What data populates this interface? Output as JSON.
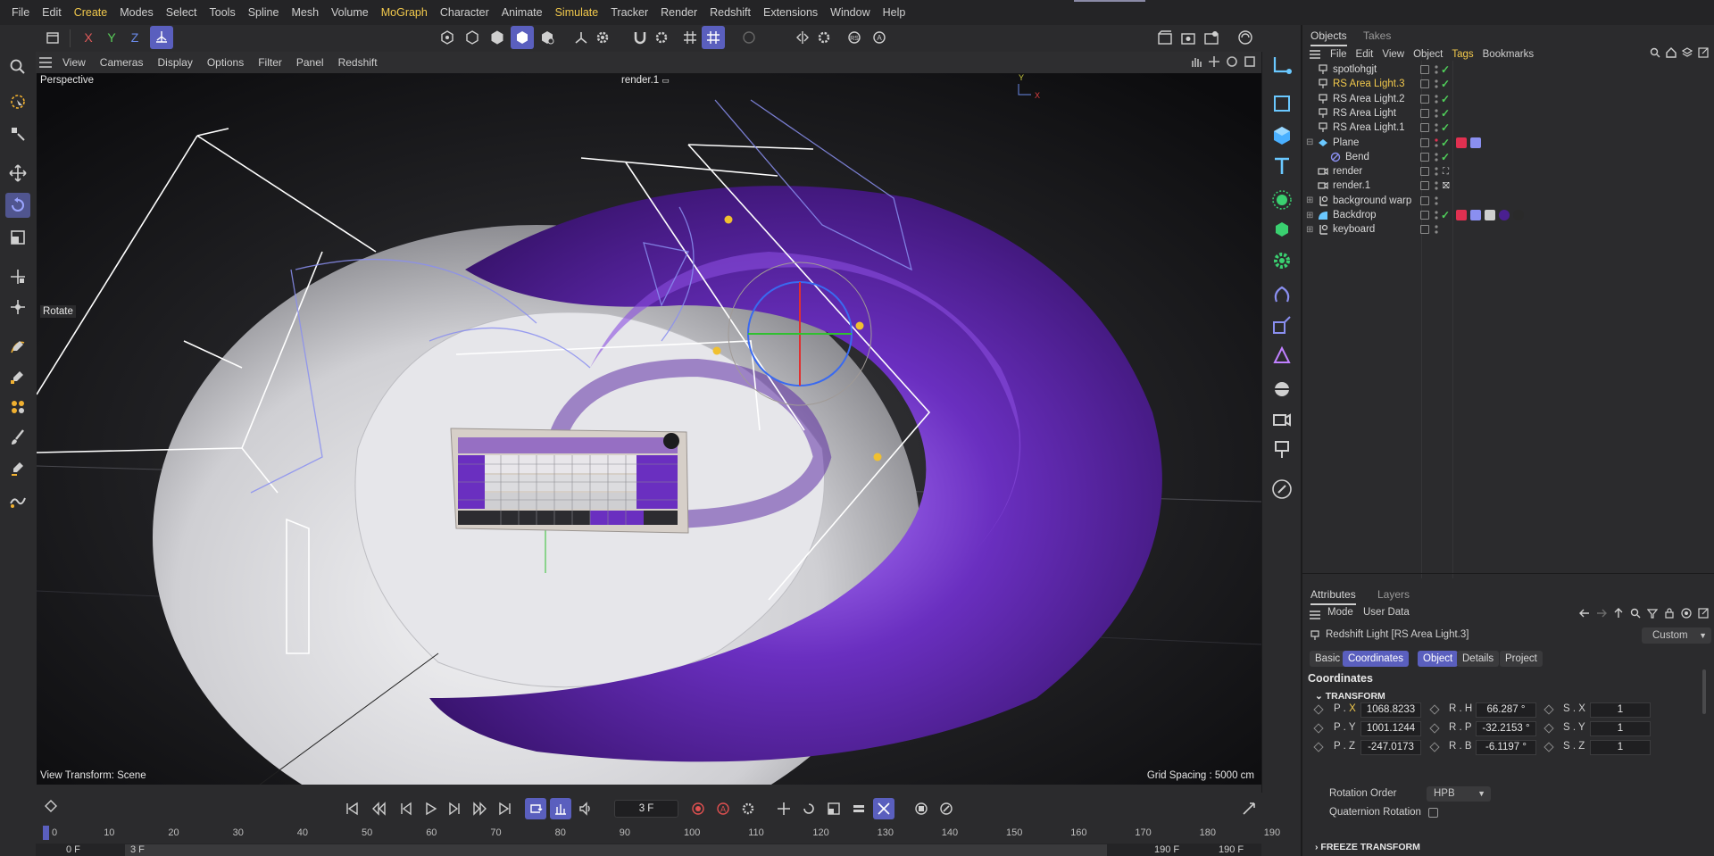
{
  "menu": [
    "File",
    "Edit",
    "Create",
    "Modes",
    "Select",
    "Tools",
    "Spline",
    "Mesh",
    "Volume",
    "MoGraph",
    "Character",
    "Animate",
    "Simulate",
    "Tracker",
    "Render",
    "Redshift",
    "Extensions",
    "Window",
    "Help"
  ],
  "menu_accent": [
    "Create",
    "MoGraph",
    "Simulate"
  ],
  "axis_buttons": [
    "X",
    "Y",
    "Z"
  ],
  "viewport_menu": [
    "View",
    "Cameras",
    "Display",
    "Options",
    "Filter",
    "Panel",
    "Redshift"
  ],
  "viewport": {
    "projection": "Perspective",
    "camera": "render.1",
    "tool_label": "Rotate",
    "view_transform": "View Transform: Scene",
    "grid_spacing": "Grid Spacing : 5000 cm"
  },
  "panel_tabs": {
    "objects": "Objects",
    "takes": "Takes"
  },
  "objects_menu": [
    "File",
    "Edit",
    "View",
    "Object",
    "Tags",
    "Bookmarks"
  ],
  "objects": [
    {
      "name": "spotlohgjt",
      "icon": "light-icon",
      "selected": false,
      "check": true
    },
    {
      "name": "RS Area Light.3",
      "icon": "light-icon",
      "selected": true,
      "check": true
    },
    {
      "name": "RS Area Light.2",
      "icon": "light-icon",
      "selected": false,
      "check": true
    },
    {
      "name": "RS Area Light",
      "icon": "light-icon",
      "selected": false,
      "check": true
    },
    {
      "name": "RS Area Light.1",
      "icon": "light-icon",
      "selected": false,
      "check": true
    },
    {
      "name": "Plane",
      "icon": "plane-icon",
      "selected": false,
      "check": true
    },
    {
      "name": "Bend",
      "icon": "bend-icon",
      "selected": false,
      "check": true
    },
    {
      "name": "render",
      "icon": "camera-icon",
      "selected": false,
      "check": false
    },
    {
      "name": "render.1",
      "icon": "camera-icon",
      "selected": false,
      "check": false
    },
    {
      "name": "background warp",
      "icon": "null-icon",
      "selected": false,
      "check": false
    },
    {
      "name": "Backdrop",
      "icon": "backdrop-icon",
      "selected": false,
      "check": true
    },
    {
      "name": "keyboard",
      "icon": "null-icon",
      "selected": false,
      "check": false
    }
  ],
  "attr_tabs": {
    "attributes": "Attributes",
    "layers": "Layers"
  },
  "attr_menu": {
    "mode": "Mode",
    "user_data": "User Data"
  },
  "attr_object_title": "Redshift Light [RS Area Light.3]",
  "attr_preset": "Custom",
  "attr_buttons": [
    "Basic",
    "Coordinates",
    "Object",
    "Details",
    "Project"
  ],
  "attr_buttons_active": [
    "Coordinates",
    "Object"
  ],
  "coordinates_title": "Coordinates",
  "transform_title": "TRANSFORM",
  "transform": [
    {
      "p_label": "P . X",
      "p_val": "1068.8233",
      "r_label": "R . H",
      "r_val": "66.287 °",
      "s_label": "S . X",
      "s_val": "1"
    },
    {
      "p_label": "P . Y",
      "p_val": "1001.1244",
      "r_label": "R . P",
      "r_val": "-32.2153 °",
      "s_label": "S . Y",
      "s_val": "1"
    },
    {
      "p_label": "P . Z",
      "p_val": "-247.0173",
      "r_label": "R . B",
      "r_val": "-6.1197 °",
      "s_label": "S . Z",
      "s_val": "1"
    }
  ],
  "rotation_order_label": "Rotation Order",
  "rotation_order_value": "HPB",
  "quaternion_label": "Quaternion Rotation",
  "freeze_title": "FREEZE TRANSFORM",
  "timeline": {
    "current_frame": "3 F",
    "start": "0 F",
    "range_start": "3 F",
    "range_end": "190 F",
    "end": "190 F",
    "ruler": [
      "0",
      "10",
      "20",
      "30",
      "40",
      "50",
      "60",
      "70",
      "80",
      "90",
      "100",
      "110",
      "120",
      "130",
      "140",
      "150",
      "160",
      "170",
      "180",
      "190"
    ]
  },
  "colors": {
    "accent": "#5a5fbe",
    "selected_text": "#f2c94c",
    "purple": "#6a2fc0",
    "check": "#50d05a"
  }
}
